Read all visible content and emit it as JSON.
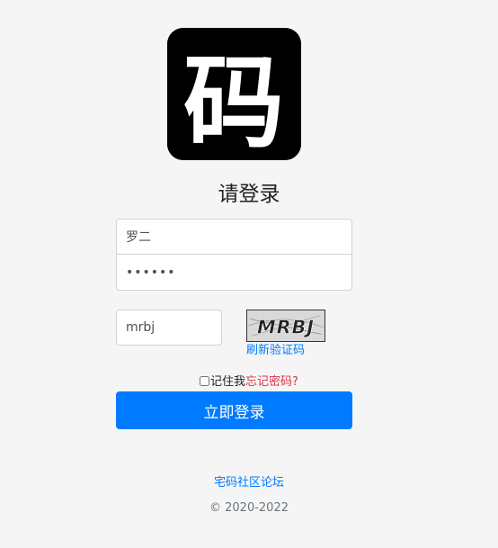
{
  "logo": {
    "glyph": "码",
    "icon": "ma-character-logo"
  },
  "title": "请登录",
  "form": {
    "username_value": "罗二",
    "password_value": "••••••",
    "captcha_value": "mrbj",
    "captcha_image_text": "MRBJ",
    "refresh_label": "刷新验证码",
    "remember_label": "记住我",
    "forgot_label": "忘记密码?",
    "submit_label": "立即登录"
  },
  "footer": {
    "forum_link": "宅码社区论坛",
    "copyright": "© 2020-2022"
  },
  "colors": {
    "primary": "#007bff",
    "danger": "#dc3545",
    "background": "#f5f5f5"
  }
}
